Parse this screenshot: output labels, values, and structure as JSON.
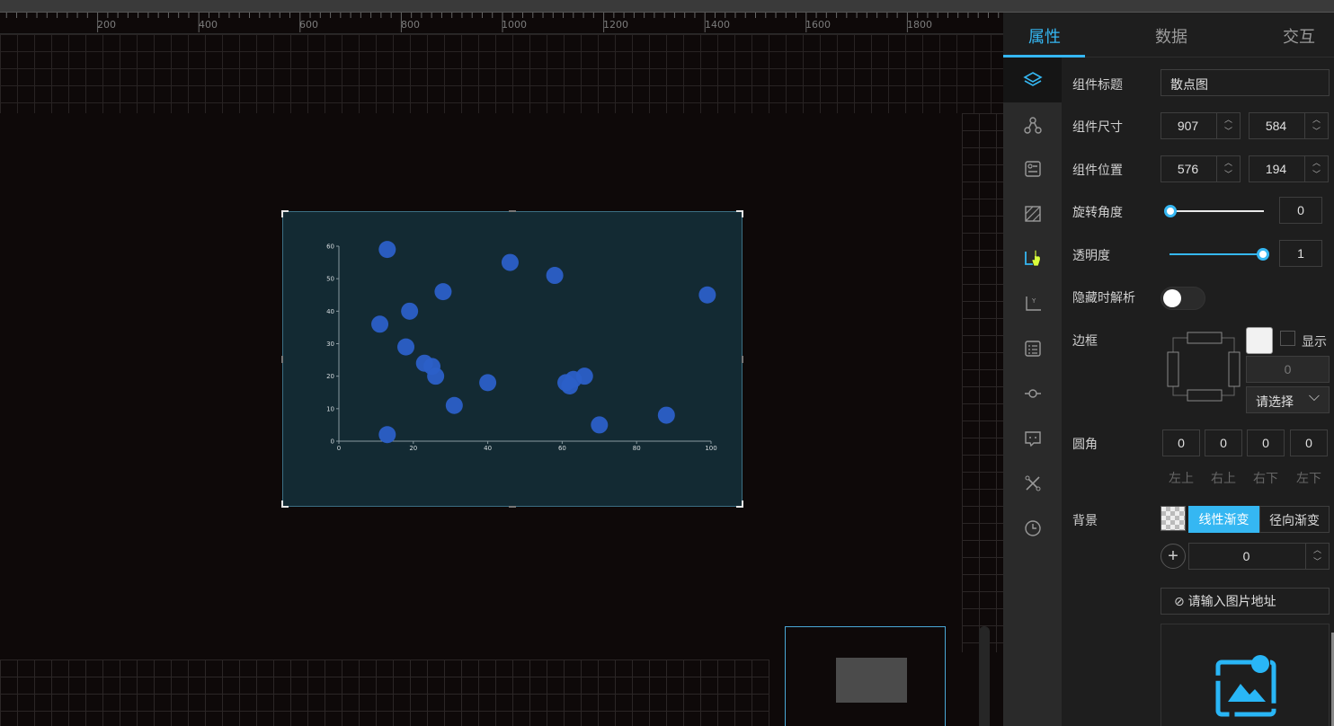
{
  "ruler": {
    "labels": [
      "200",
      "400",
      "600",
      "800",
      "1000",
      "1200",
      "1400",
      "1600",
      "1800"
    ]
  },
  "chart_data": {
    "type": "scatter",
    "title": "",
    "xlabel": "",
    "ylabel": "",
    "xlim": [
      0,
      100
    ],
    "ylim": [
      0,
      60
    ],
    "x_ticks": [
      "0",
      "20",
      "40",
      "60",
      "80",
      "100"
    ],
    "y_ticks": [
      "0",
      "10",
      "20",
      "30",
      "40",
      "50",
      "60"
    ],
    "point_color": "#2b5fc8",
    "grid": false,
    "points": [
      {
        "x": 13,
        "y": 59
      },
      {
        "x": 46,
        "y": 55
      },
      {
        "x": 58,
        "y": 51
      },
      {
        "x": 28,
        "y": 46
      },
      {
        "x": 99,
        "y": 45
      },
      {
        "x": 19,
        "y": 40
      },
      {
        "x": 11,
        "y": 36
      },
      {
        "x": 18,
        "y": 29
      },
      {
        "x": 23,
        "y": 24
      },
      {
        "x": 25,
        "y": 23
      },
      {
        "x": 26,
        "y": 20
      },
      {
        "x": 66,
        "y": 20
      },
      {
        "x": 63,
        "y": 19
      },
      {
        "x": 61,
        "y": 18
      },
      {
        "x": 62,
        "y": 17
      },
      {
        "x": 40,
        "y": 18
      },
      {
        "x": 31,
        "y": 11
      },
      {
        "x": 88,
        "y": 8
      },
      {
        "x": 70,
        "y": 5
      },
      {
        "x": 13,
        "y": 2
      }
    ]
  },
  "panel": {
    "tabs": [
      "属性",
      "数据",
      "交互"
    ],
    "active_tab": "属性",
    "accent_color": "#35b7f2",
    "title_label": "组件标题",
    "title_value": "散点图",
    "size_label": "组件尺寸",
    "width": "907",
    "height": "584",
    "position_label": "组件位置",
    "pos_x": "576",
    "pos_y": "194",
    "rotation_label": "旋转角度",
    "rotation_value": "0",
    "rotation_level": 0,
    "opacity_label": "透明度",
    "opacity_value": "1",
    "opacity_level": 1,
    "hide_parse_label": "隐藏时解析",
    "hide_parse_on": false,
    "border_label": "边框",
    "border_show_label": "显示",
    "border_width": "0",
    "border_select": "请选择",
    "radius_label": "圆角",
    "radius_values": [
      "0",
      "0",
      "0",
      "0"
    ],
    "radius_corner_labels": [
      "左上",
      "右上",
      "右下",
      "左下"
    ],
    "background_label": "背景",
    "linear_gradient": "线性渐变",
    "radial_gradient": "径向渐变",
    "gradient_angle": "0",
    "image_url_placeholder": "请输入图片地址"
  },
  "side_icons": [
    "layers-icon",
    "nodes-icon",
    "settings-panel-icon",
    "hatch-icon",
    "chart-axis-icon",
    "y-axis-icon",
    "list-icon",
    "point-line-icon",
    "tooltip-icon",
    "tools-icon",
    "history-icon"
  ]
}
